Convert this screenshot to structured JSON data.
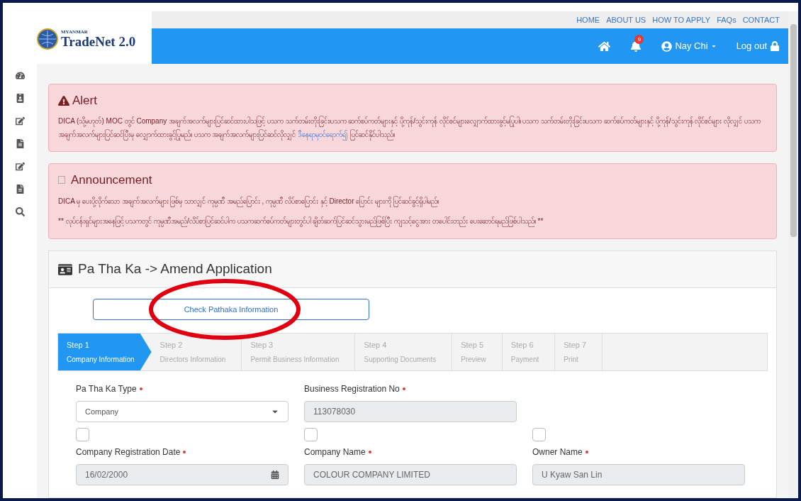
{
  "logo": {
    "small": "MYANMAR",
    "name": "TradeNet 2.0"
  },
  "top_links": [
    "HOME",
    "ABOUT US",
    "HOW TO APPLY",
    "FAQs",
    "CONTACT"
  ],
  "header": {
    "notifications": "9",
    "user": "Nay Chi",
    "logout": "Log out"
  },
  "alert": {
    "title": "Alert",
    "text": "DICA (သို့မဟုတ်) MOC တွင် Company အချက်အလက်များပြင်ဆင်ထားပါသဖြင့် ပသက သက်တမ်းတိုးခြင်း၊ပသက ဆက်စပ်ကတ်များနှင့် ပို့ကုန်/သွင်းကုန် လိုင်စင်များလျှောက်ထားခွင့်မပြုပါ။ ပသက သက်တမ်းတိုးခြင်း၊ပသက ဆက်စပ်ကတ်များနှင့် ပို့ကုန်/သွင်းကုန် လိုင်စင်များ လိုလျှင် ပသက အချက်အလက်များပြင်ဆင်ပြီးမှ လျှောက်ထားခွင့်ပြုမည်။ ပသက အချက်အလက်များပြင်ဆင်လိုလျှင်",
    "link": "ဒီနေရာမှဝင်ရောက်၍",
    "after": "ပြင်ဆင်နိုင်ပါသည်။"
  },
  "announcement": {
    "title": "Announcement",
    "lines": [
      "DICA မှ ပေးပို့လိုက်သော အချက်အလက်များ ဖြစ်မှ သာလျှင် ကုမ္ပဏီ အမည်ပြောင်း , ကုမ္ပဏီ လိပ်စာပြောင်း နှင့် Director ပြောင်း များကို ပြင်ဆင်ခွင့်ရှိပါမည်။",
      "** လုပ်ငန်းရှင်များအနေဖြင့် ပသကတွင် ကုမ္ပဏီအမည်/လိပ်စာပြင်ဆင်ပါက ပသကဆက်စပ်ကတ်များတွင်ပါ ချိတ်ဆက်ပြင်ဆင်သွားမည်ဖြစ်ပြီး ကျသင့်ငွေအား တပေါင်းတည်း ပေးဆောင်ရမည်ဖြစ်ပါသည်။ **"
    ]
  },
  "card": {
    "title": "Pa Tha Ka -> Amend Application",
    "check_button": "Check Pathaka Information"
  },
  "steps": [
    {
      "step": "Step 1",
      "label": "Company Information",
      "selected": true
    },
    {
      "step": "Step 2",
      "label": "Directors Information",
      "selected": false
    },
    {
      "step": "Step 3",
      "label": "Permit Business Information",
      "selected": false
    },
    {
      "step": "Step 4",
      "label": "Supporting Documents",
      "selected": false
    },
    {
      "step": "Step 5",
      "label": "Preview",
      "selected": false
    },
    {
      "step": "Step 6",
      "label": "Payment",
      "selected": false
    },
    {
      "step": "Step 7",
      "label": "Print",
      "selected": false
    }
  ],
  "form_rows": [
    {
      "checkboxes": [],
      "fields": [
        {
          "label": "Pa Tha Ka Type",
          "kind": "select",
          "value": "Company",
          "required": true
        },
        {
          "label": "Business Registration No",
          "kind": "text",
          "value": "113078030",
          "required": true
        }
      ]
    },
    {
      "checkboxes": [
        {
          "checked": false
        },
        {
          "checked": false
        },
        {
          "checked": false
        }
      ],
      "fields": [
        {
          "label": "Company Registration Date",
          "kind": "date",
          "value": "16/02/2000",
          "required": true
        },
        {
          "label": "Company Name",
          "kind": "text",
          "value": "COLOUR COMPANY LIMITED",
          "required": true
        },
        {
          "label": "Owner Name",
          "kind": "text",
          "value": "U Kyaw San Lin",
          "required": true
        }
      ]
    }
  ]
}
